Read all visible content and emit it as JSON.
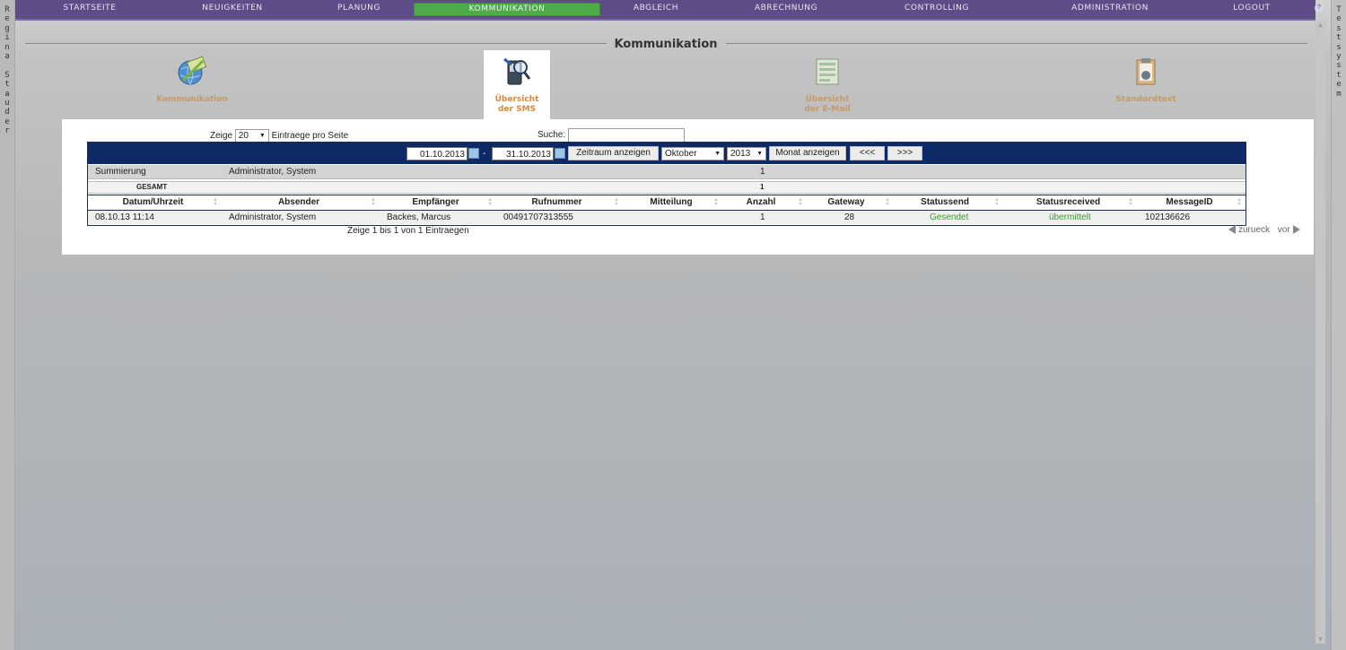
{
  "side": {
    "left_text": [
      "R",
      "e",
      "g",
      "i",
      "n",
      "a",
      " ",
      "S",
      "t",
      "a",
      "u",
      "d",
      "e",
      "r"
    ],
    "right_text": [
      "T",
      "e",
      "s",
      "t",
      "s",
      "y",
      "s",
      "t",
      "e",
      "m"
    ]
  },
  "nav": {
    "items": [
      "STARTSEITE",
      "NEUIGKEITEN",
      "PLANUNG",
      "KOMMUNIKATION",
      "ABGLEICH",
      "ABRECHNUNG",
      "CONTROLLING",
      "ADMINISTRATION",
      "LOGOUT"
    ],
    "active": "KOMMUNIKATION",
    "help_glyph": "?"
  },
  "section_title": "Kommunikation",
  "modules": [
    {
      "line1": "Kommunikation",
      "line2": ""
    },
    {
      "line1": "Übersicht",
      "line2": "der SMS"
    },
    {
      "line1": "Übersicht",
      "line2": "der E-Mail"
    },
    {
      "line1": "Standardtext",
      "line2": ""
    }
  ],
  "controls": {
    "show_label": "Zeige",
    "page_size": "20",
    "per_page_label": "Eintraege pro Seite",
    "search_label": "Suche:",
    "search_value": ""
  },
  "toolbar": {
    "date_from": "01.10.2013",
    "date_to": "31.10.2013",
    "dash": "-",
    "range_button": "Zeitraum anzeigen",
    "month": "Oktober",
    "year": "2013",
    "month_button": "Monat anzeigen",
    "prev_button": "<<<",
    "next_button": ">>>"
  },
  "summary": {
    "label": "Summierung",
    "sender": "Administrator, System",
    "count": "1",
    "total_label": "GESAMT",
    "total_count": "1"
  },
  "table": {
    "columns": [
      "Datum/Uhrzeit",
      "Absender",
      "Empfänger",
      "Rufnummer",
      "Mitteilung",
      "Anzahl",
      "Gateway",
      "Statussend",
      "Statusreceived",
      "MessageID"
    ],
    "rows": [
      {
        "datum": "08.10.13 11:14",
        "absender": "Administrator, System",
        "empfaenger": "Backes, Marcus",
        "rufnummer": "00491707313555",
        "mitteilung": "",
        "anzahl": "1",
        "gateway": "28",
        "statussend": "Gesendet",
        "statusreceived": "übermittelt",
        "messageid": "102136626"
      }
    ]
  },
  "footer": {
    "info": "Zeige 1 bis 1 von 1 Eintraegen",
    "prev": "zurueck",
    "next": "vor"
  },
  "colors": {
    "nav_bg": "#5e4c86",
    "nav_active": "#4faa4a",
    "table_header_bar": "#0d2a66",
    "status_green": "#3f9a2e",
    "module_label": "#c79a64"
  }
}
